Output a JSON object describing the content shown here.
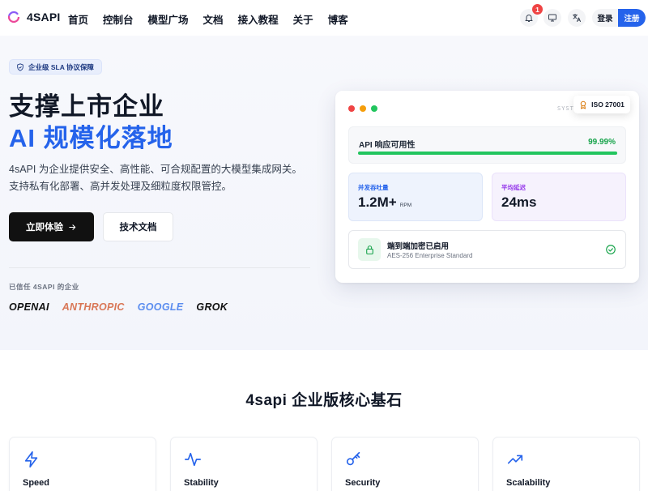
{
  "header": {
    "brand": "4SAPI",
    "nav": [
      "首页",
      "控制台",
      "模型广场",
      "文档",
      "接入教程",
      "关于",
      "博客"
    ],
    "notification_count": "1",
    "login": "登录",
    "register": "注册"
  },
  "hero": {
    "pill": "企业级 SLA 协议保障",
    "title_line1": "支撑上市企业",
    "title_line2": "AI 规模化落地",
    "description": "4sAPI 为企业提供安全、高性能、可合规配置的大模型集成网关。支持私有化部署、高并发处理及细粒度权限管控。",
    "primary_button": "立即体验",
    "secondary_button": "技术文档",
    "trusted_label": "已信任 4SAPI 的企业",
    "trusted_brands": [
      {
        "name": "OPENAI",
        "color": "#111111"
      },
      {
        "name": "ANTHROPIC",
        "color": "#d97757"
      },
      {
        "name": "GOOGLE",
        "color": "#5b8def"
      },
      {
        "name": "GROK",
        "color": "#111111"
      }
    ]
  },
  "card": {
    "system_label": "SYSTE",
    "iso_badge": "ISO 27001",
    "availability_label": "API 响应可用性",
    "availability_value": "99.99%",
    "availability_fraction": 0.9999,
    "throughput_label": "并发吞吐量",
    "throughput_value": "1.2M+",
    "throughput_unit": "RPM",
    "latency_label": "平均延迟",
    "latency_value": "24ms",
    "encryption_title": "端到端加密已启用",
    "encryption_subtitle": "AES-256 Enterprise Standard"
  },
  "features": {
    "section_title": "4sapi 企业版核心基石",
    "items": [
      {
        "title": "Speed",
        "icon": "lightning-icon"
      },
      {
        "title": "Stability",
        "icon": "pulse-icon"
      },
      {
        "title": "Security",
        "icon": "key-icon"
      },
      {
        "title": "Scalability",
        "icon": "trending-up-icon"
      }
    ]
  },
  "colors": {
    "accent": "#2563eb",
    "success": "#16a34a",
    "throughput_label": "#2563eb",
    "latency_label": "#9333ea"
  }
}
